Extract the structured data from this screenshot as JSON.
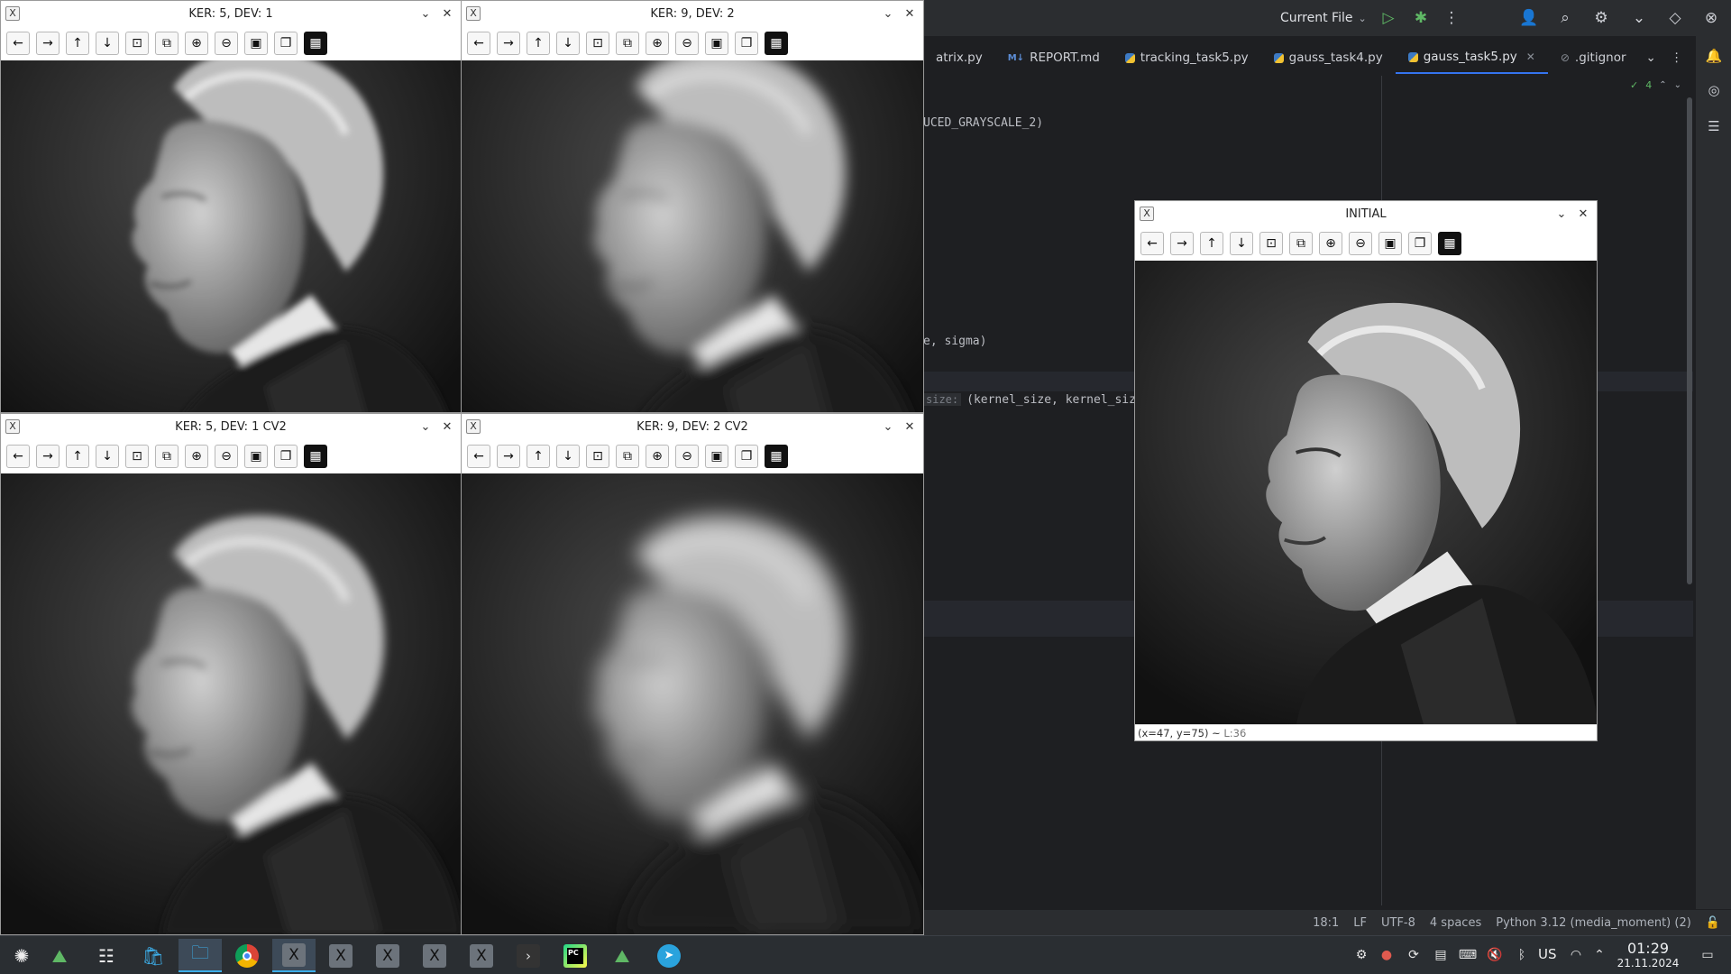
{
  "ide": {
    "run_config": "Current File",
    "tabs": [
      {
        "label": "atrix.py",
        "icon": "python-file-icon"
      },
      {
        "label": "REPORT.md",
        "icon": "markdown-file-icon"
      },
      {
        "label": "tracking_task5.py",
        "icon": "python-file-icon"
      },
      {
        "label": "gauss_task4.py",
        "icon": "python-file-icon"
      },
      {
        "label": "gauss_task5.py",
        "icon": "python-file-icon",
        "active": true
      },
      {
        "label": ".gitignor",
        "icon": "ignore-file-icon"
      }
    ],
    "code_lines": {
      "line1": "UCED_GRAYSCALE_2)",
      "line2": "e, sigma)",
      "line3_hint": "size:",
      "line3": "(kernel_size, kernel_size"
    },
    "inspection_count": "4",
    "status": {
      "position": "18:1",
      "line_sep": "LF",
      "encoding": "UTF-8",
      "indent": "4 spaces",
      "interpreter": "Python 3.12 (media_moment) (2)"
    }
  },
  "windows": [
    {
      "title": "KER: 5, DEV: 1"
    },
    {
      "title": "KER: 9, DEV: 2"
    },
    {
      "title": "KER: 5, DEV: 1 CV2"
    },
    {
      "title": "KER: 9, DEV: 2 CV2"
    },
    {
      "title": "INITIAL",
      "coords": "(x=47, y=75) ~",
      "lum": "L:36"
    }
  ],
  "toolbar_icons": [
    "arrow-left-icon",
    "arrow-right-icon",
    "arrow-up-icon",
    "arrow-down-icon",
    "zoom-rect-icon",
    "zoom-fit-icon",
    "zoom-in-icon",
    "zoom-out-icon",
    "save-icon",
    "copy-icon",
    "properties-icon"
  ],
  "taskbar": {
    "keyboard_layout": "US",
    "time": "01:29",
    "date": "21.11.2024"
  }
}
